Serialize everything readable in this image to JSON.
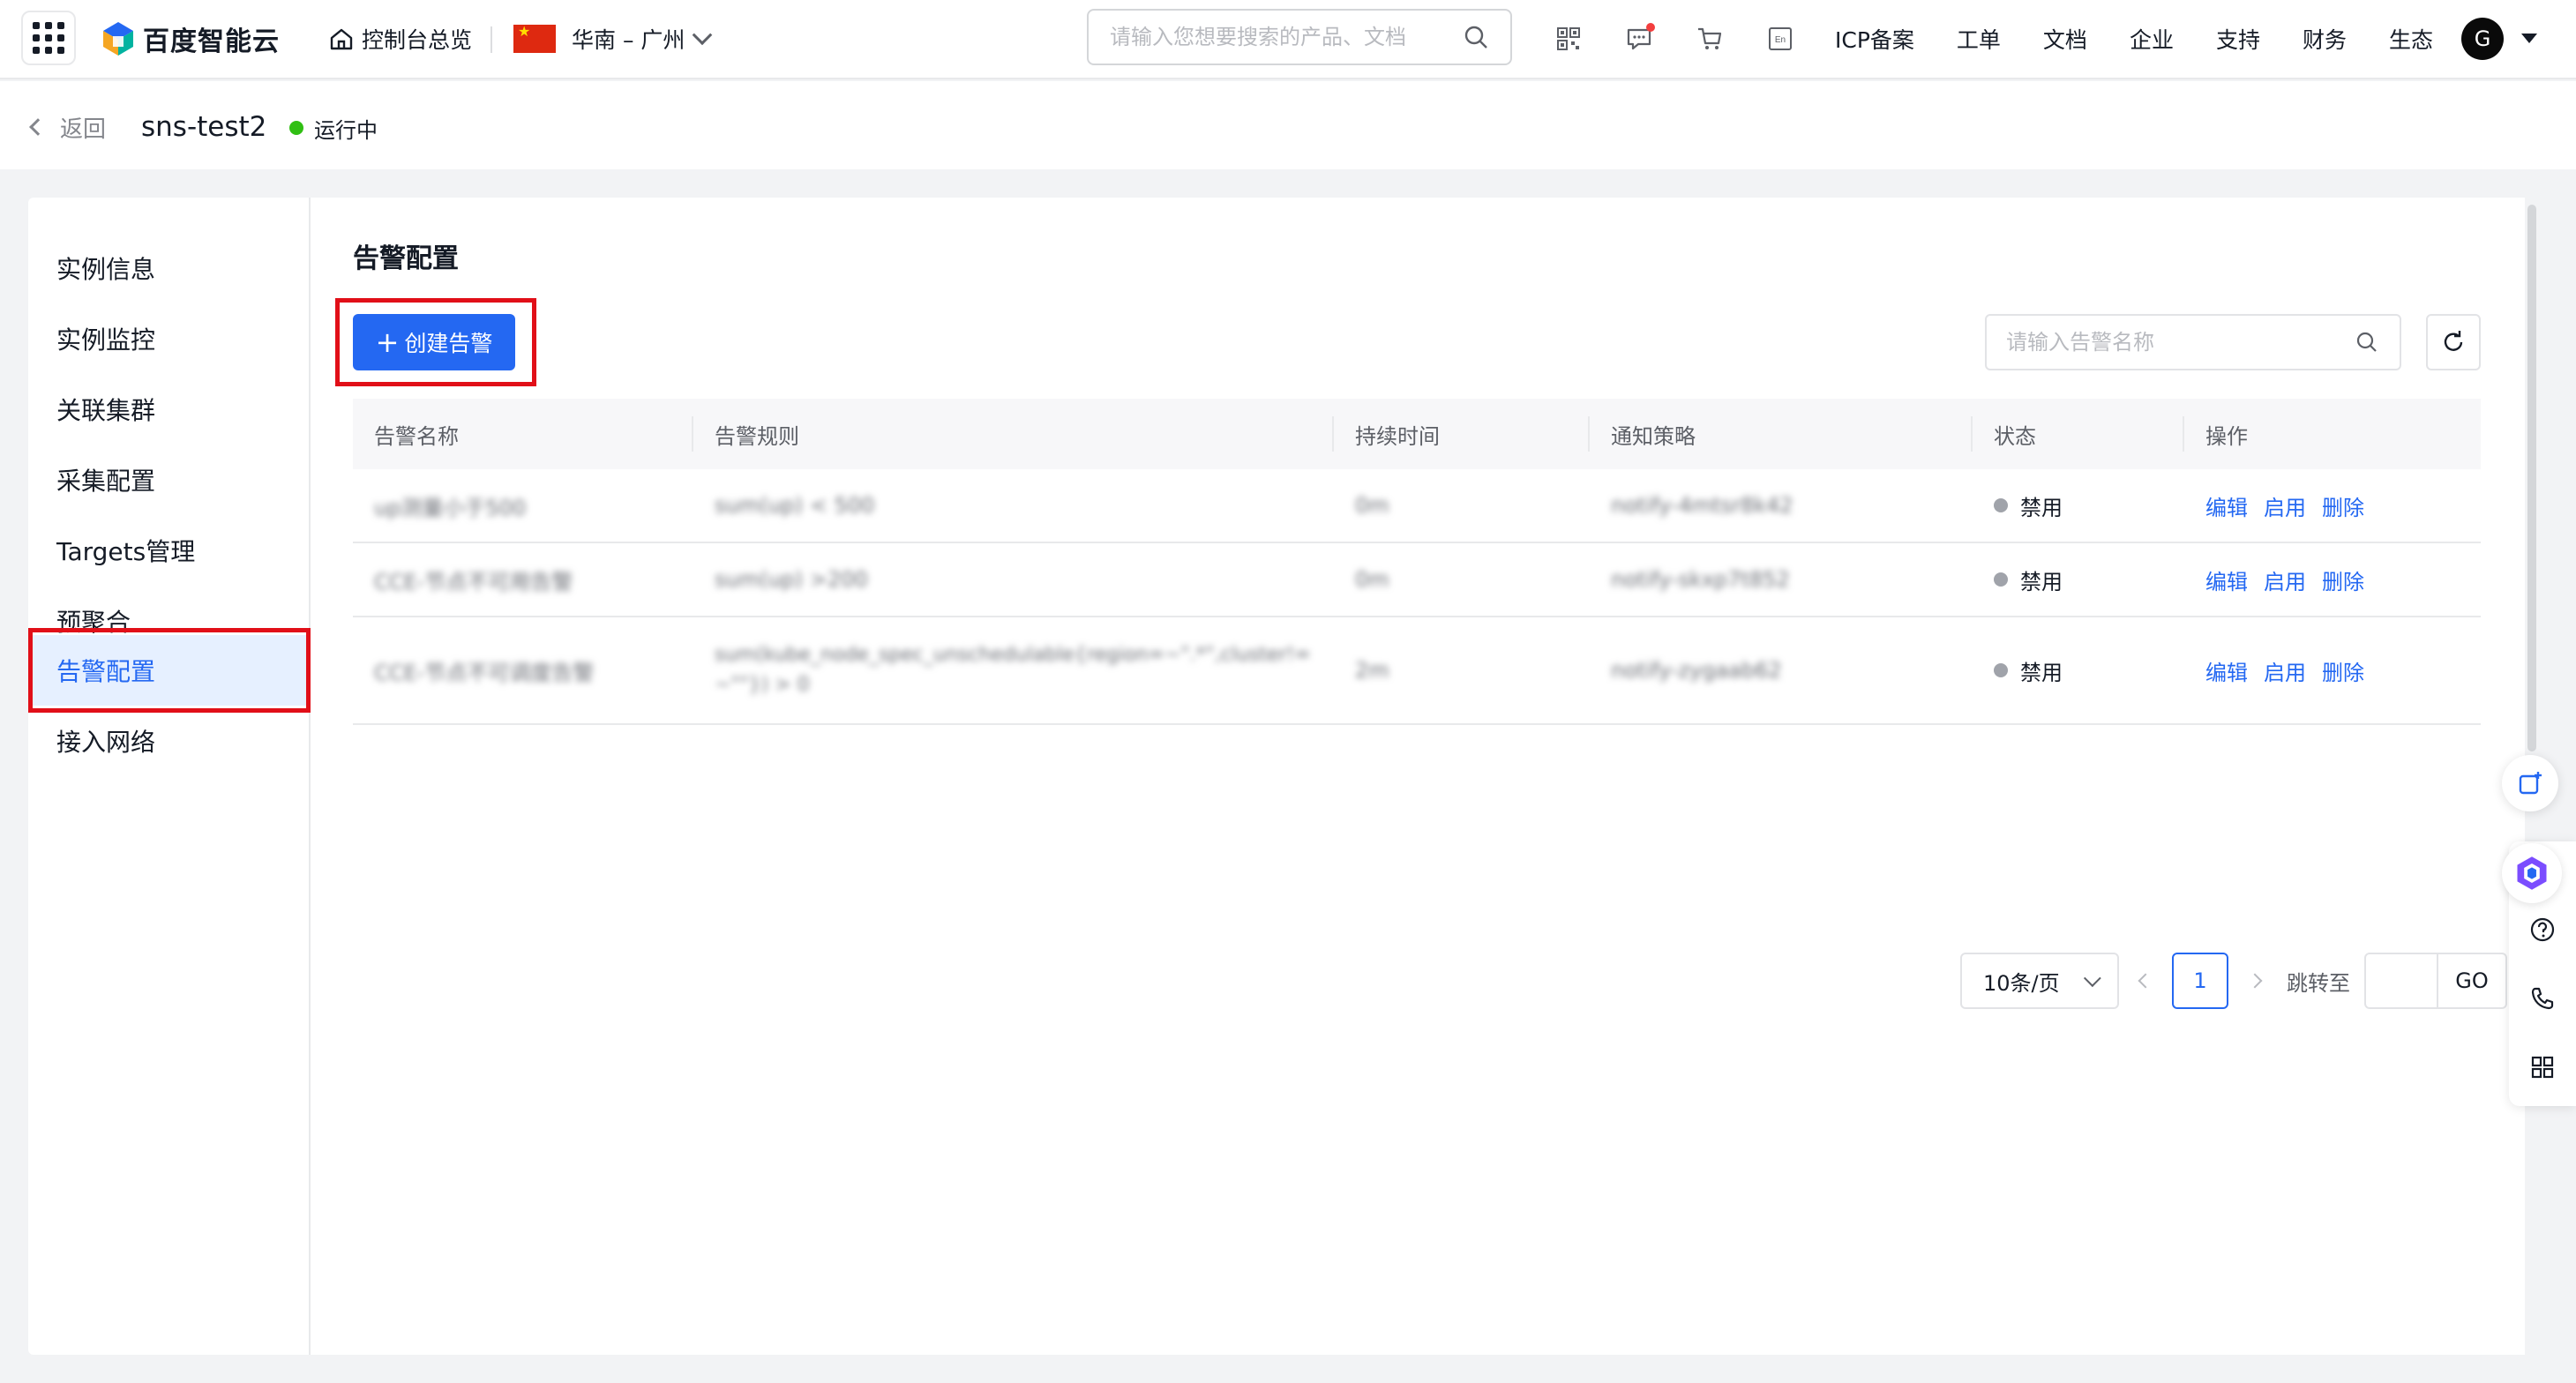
{
  "topbar": {
    "logo_text": "百度智能云",
    "console_label": "控制台总览",
    "region_label": "华南 – 广州",
    "search_placeholder": "请输入您想要搜索的产品、文档",
    "links": [
      "ICP备案",
      "工单",
      "文档",
      "企业",
      "支持",
      "财务",
      "生态"
    ],
    "avatar_letter": "G",
    "icons": [
      "qrcode-icon",
      "message-icon",
      "cart-icon",
      "language-en-icon"
    ]
  },
  "subheader": {
    "back_label": "返回",
    "instance_name": "sns-test2",
    "status_label": "运行中"
  },
  "sidebar": {
    "items": [
      {
        "label": "实例信息"
      },
      {
        "label": "实例监控"
      },
      {
        "label": "关联集群"
      },
      {
        "label": "采集配置"
      },
      {
        "label": "Targets管理"
      },
      {
        "label": "预聚合"
      },
      {
        "label": "告警配置",
        "active": true
      },
      {
        "label": "接入网络"
      }
    ]
  },
  "main": {
    "title": "告警配置",
    "create_button": "创建告警",
    "search_placeholder": "请输入告警名称",
    "table": {
      "headers": [
        "告警名称",
        "告警规则",
        "持续时间",
        "通知策略",
        "状态",
        "操作"
      ],
      "rows": [
        {
          "name": "up测量小于500",
          "rule": "sum(up) < 500",
          "duration": "0m",
          "policy": "notify-4mtsr8k42",
          "status": "禁用",
          "actions": [
            "编辑",
            "启用",
            "删除"
          ]
        },
        {
          "name": "CCE-节点不可用告警",
          "rule": "sum(up) >200",
          "duration": "0m",
          "policy": "notify-skxp7t852",
          "status": "禁用",
          "actions": [
            "编辑",
            "启用",
            "删除"
          ]
        },
        {
          "name": "CCE-节点不可调度告警",
          "rule": "sum(kube_node_spec_unschedulable{region=~\".*\",cluster!=~\"\"}) > 0",
          "duration": "2m",
          "policy": "notify-zygaab62",
          "status": "禁用",
          "actions": [
            "编辑",
            "启用",
            "删除"
          ]
        }
      ]
    },
    "pagination": {
      "page_size": "10条/页",
      "current_page": "1",
      "jump_label": "跳转至",
      "go_label": "GO"
    }
  },
  "colors": {
    "primary": "#2468f2",
    "highlight_box": "#e10f18",
    "running": "#30bf13",
    "disabled_dot": "#a0a3aa"
  }
}
